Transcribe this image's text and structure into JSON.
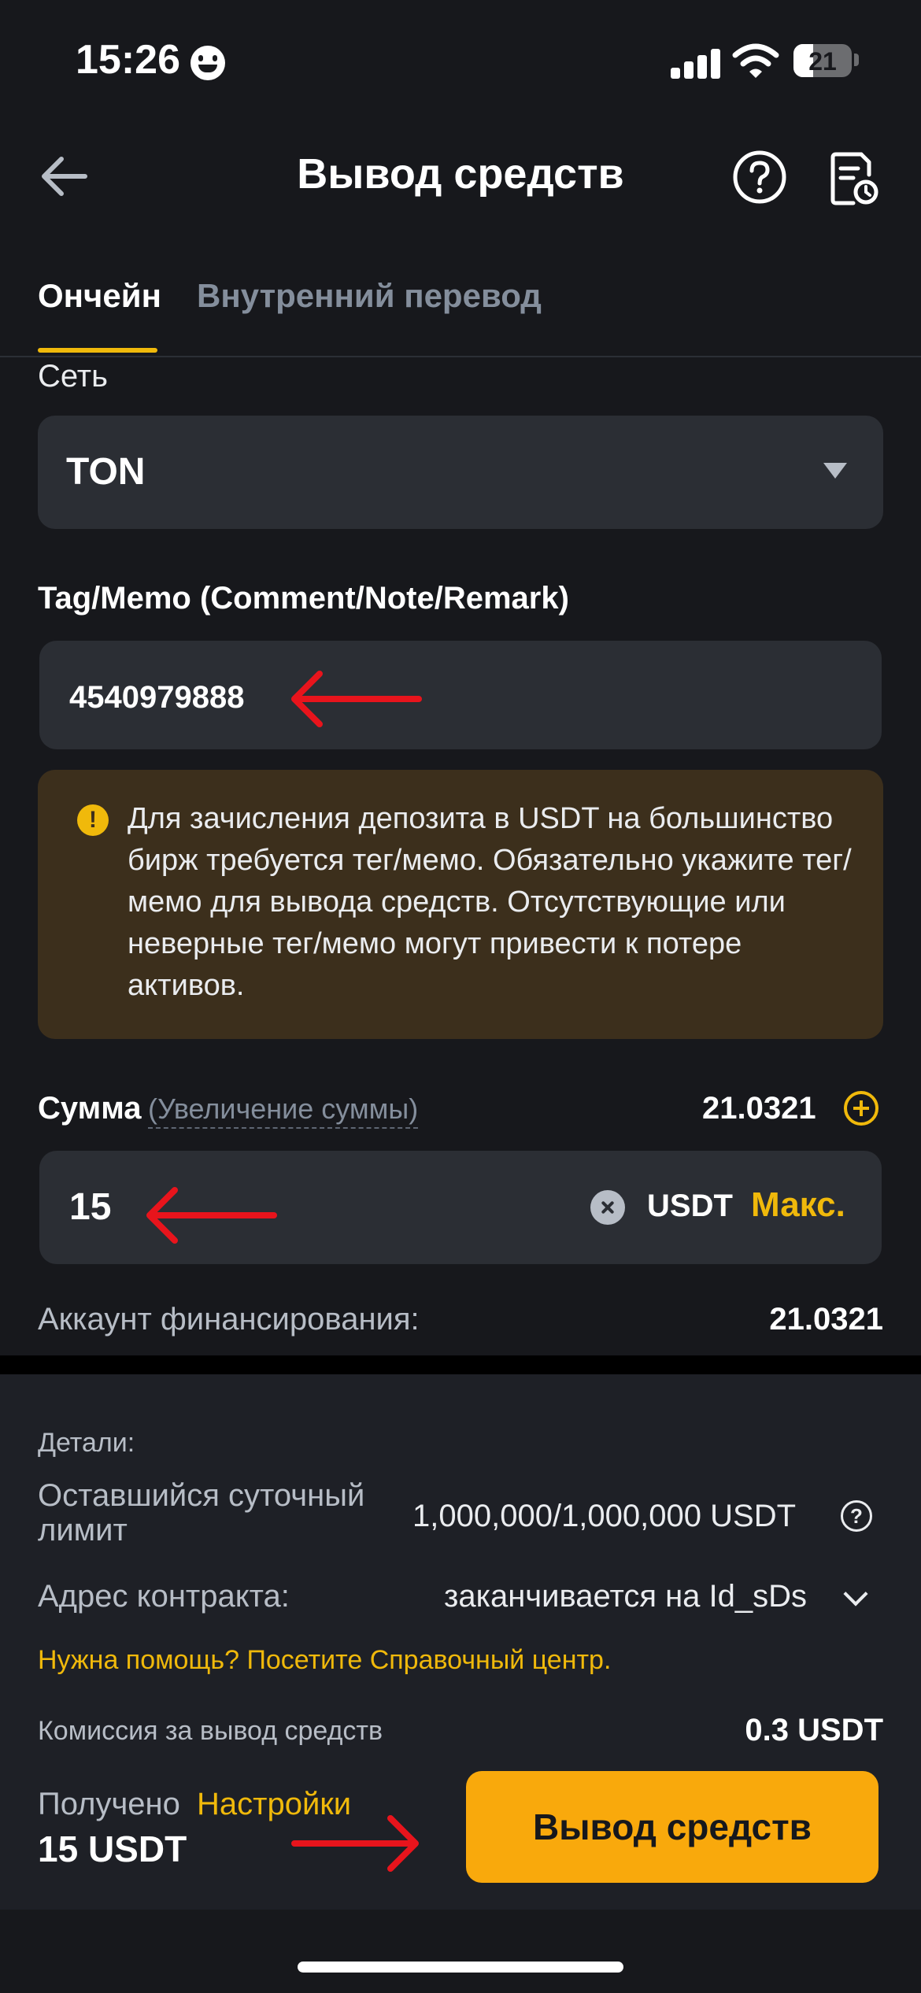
{
  "status_bar": {
    "time": "15:26",
    "battery": "21"
  },
  "header": {
    "title": "Вывод средств"
  },
  "tabs": [
    {
      "label": "Ончейн",
      "active": true
    },
    {
      "label": "Внутренний перевод",
      "active": false
    }
  ],
  "network": {
    "label": "Сеть",
    "value": "TON"
  },
  "memo": {
    "label": "Tag/Memo (Comment/Note/Remark)",
    "value": "4540979888"
  },
  "warning": {
    "text": "Для зачисления депозита в USDT на большинство бирж требуется тег/мемо. Обязательно укажите тег/мемо для вывода средств. Отсутствующие или неверные тег/мемо могут привести к потере активов.",
    "icon": "!"
  },
  "amount": {
    "label": "Сумма",
    "hint": "(Увеличение суммы)",
    "balance": "21.0321",
    "value": "15",
    "currency": "USDT",
    "max_label": "Макс."
  },
  "account": {
    "label": "Аккаунт финансирования:",
    "value": "21.0321"
  },
  "details": {
    "label": "Детали:",
    "limit_label": "Оставшийся суточный лимит",
    "limit_value": "1,000,000/1,000,000 USDT",
    "limit_help": "?",
    "contract_label": "Адрес контракта:",
    "contract_value": "заканчивается на Id_sDs",
    "help_link": "Нужна помощь? Посетите Справочный центр.",
    "fee_label": "Комиссия за вывод средств",
    "fee_value": "0.3 USDT"
  },
  "footer": {
    "received_label": "Получено",
    "settings_label": "Настройки",
    "received_value": "15 USDT",
    "submit_label": "Вывод средств"
  },
  "colors": {
    "background": "#17181c",
    "accent": "#f0b90b",
    "button": "#f9a90c",
    "warning_bg": "#3c2f1c",
    "annotation_arrow": "#e8141c"
  },
  "icons": [
    "back-arrow-icon",
    "help-icon",
    "history-icon",
    "caret-down-icon",
    "warning-icon",
    "plus-circle-icon",
    "clear-icon",
    "chevron-down-icon"
  ]
}
